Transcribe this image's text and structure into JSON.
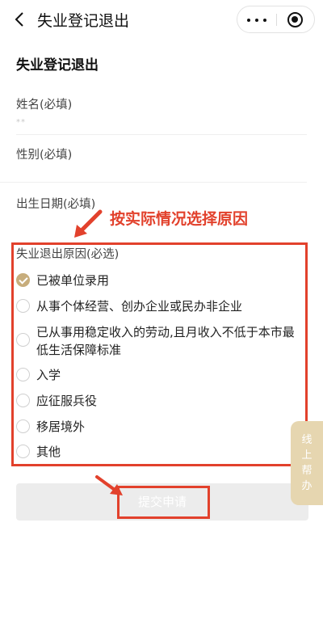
{
  "nav": {
    "title": "失业登记退出"
  },
  "page": {
    "title": "失业登记退出"
  },
  "form": {
    "name_label": "姓名(必填)",
    "name_placeholder": "**",
    "gender_label": "性别(必填)",
    "birth_label": "出生日期(必填)",
    "reason_label": "失业退出原因(必选)",
    "options": [
      {
        "label": "已被单位录用",
        "checked": true
      },
      {
        "label": "从事个体经营、创办企业或民办非企业",
        "checked": false
      },
      {
        "label": "已从事用稳定收入的劳动,且月收入不低于本市最低生活保障标准",
        "checked": false
      },
      {
        "label": "入学",
        "checked": false
      },
      {
        "label": "应征服兵役",
        "checked": false
      },
      {
        "label": "移居境外",
        "checked": false
      },
      {
        "label": "其他",
        "checked": false
      }
    ],
    "submit_label": "提交申请"
  },
  "annotation": {
    "text": "按实际情况选择原因",
    "color": "#e2412c"
  },
  "float_tab": {
    "label": "线上帮办"
  },
  "colors": {
    "accent": "#c7ad7c",
    "annotation_red": "#e2412c",
    "submit_disabled": "#ececec"
  }
}
